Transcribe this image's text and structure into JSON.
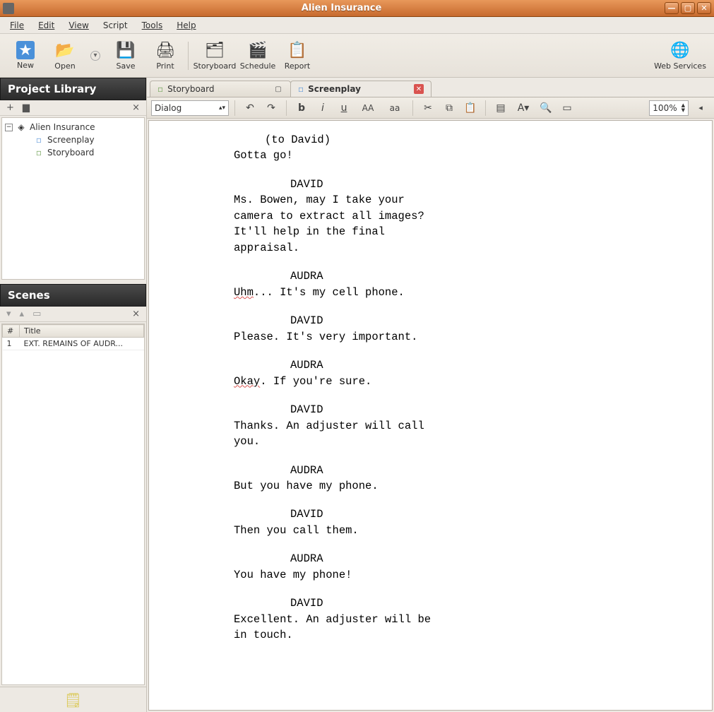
{
  "window": {
    "title": "Alien Insurance"
  },
  "menubar": [
    "File",
    "Edit",
    "View",
    "Script",
    "Tools",
    "Help"
  ],
  "toolbar": {
    "new": "New",
    "open": "Open",
    "save": "Save",
    "print": "Print",
    "storyboard": "Storyboard",
    "schedule": "Schedule",
    "report": "Report",
    "webservices": "Web Services"
  },
  "left": {
    "project_library_title": "Project Library",
    "project_root": "Alien Insurance",
    "project_items": [
      "Screenplay",
      "Storyboard"
    ],
    "scenes_title": "Scenes",
    "scenes_headers": {
      "num": "#",
      "title": "Title"
    },
    "scenes_rows": [
      {
        "num": "1",
        "title": "EXT. REMAINS OF AUDR..."
      }
    ]
  },
  "tabs": {
    "storyboard": "Storyboard",
    "screenplay": "Screenplay"
  },
  "editor_toolbar": {
    "style_combo": "Dialog",
    "zoom": "100%"
  },
  "screenplay": [
    {
      "type": "paren",
      "text": "(to David)"
    },
    {
      "type": "dialog",
      "text": "Gotta go!"
    },
    {
      "type": "gap"
    },
    {
      "type": "char",
      "text": "DAVID"
    },
    {
      "type": "dialog",
      "text": "Ms. Bowen, may I take your camera to extract all images? It'll help in the final appraisal."
    },
    {
      "type": "gap"
    },
    {
      "type": "char",
      "text": "AUDRA"
    },
    {
      "type": "dialog",
      "text": "Uhm... It's my cell phone.",
      "underline_first": "Uhm"
    },
    {
      "type": "gap"
    },
    {
      "type": "char",
      "text": "DAVID"
    },
    {
      "type": "dialog",
      "text": "Please. It's very important."
    },
    {
      "type": "gap"
    },
    {
      "type": "char",
      "text": "AUDRA"
    },
    {
      "type": "dialog",
      "text": "Okay. If you're sure.",
      "underline_first": "Okay"
    },
    {
      "type": "gap"
    },
    {
      "type": "char",
      "text": "DAVID"
    },
    {
      "type": "dialog",
      "text": "Thanks. An adjuster will call you."
    },
    {
      "type": "gap"
    },
    {
      "type": "char",
      "text": "AUDRA"
    },
    {
      "type": "dialog",
      "text": "But you have my phone."
    },
    {
      "type": "gap"
    },
    {
      "type": "char",
      "text": "DAVID"
    },
    {
      "type": "dialog",
      "text": "Then you call them."
    },
    {
      "type": "gap"
    },
    {
      "type": "char",
      "text": "AUDRA"
    },
    {
      "type": "dialog",
      "text": "You have my phone!"
    },
    {
      "type": "gap"
    },
    {
      "type": "char",
      "text": "DAVID"
    },
    {
      "type": "dialog",
      "text": "Excellent. An adjuster will be in touch."
    }
  ]
}
